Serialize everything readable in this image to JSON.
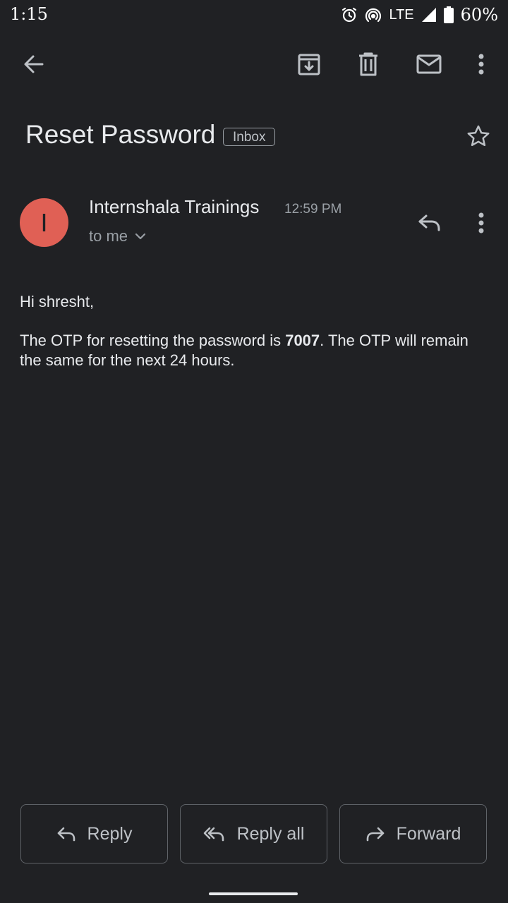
{
  "status_bar": {
    "time": "1:15",
    "network": "LTE",
    "battery_percent": "60%"
  },
  "toolbar": {
    "back_icon": "arrow-left-icon",
    "archive_icon": "archive-icon",
    "delete_icon": "trash-icon",
    "mark_unread_icon": "mail-icon",
    "more_icon": "more-vert-icon"
  },
  "email": {
    "subject": "Reset Password",
    "label": "Inbox",
    "starred": false,
    "sender": {
      "initial": "I",
      "name": "Internshala Trainings",
      "time": "12:59 PM",
      "recipients": "to me",
      "avatar_color": "#e06055"
    },
    "body": {
      "greeting": "Hi shresht,",
      "text_before": "The OTP for resetting the password is ",
      "otp": "7007",
      "text_after": ". The OTP will remain the same for the next 24 hours."
    }
  },
  "actions": {
    "reply": "Reply",
    "reply_all": "Reply all",
    "forward": "Forward"
  },
  "colors": {
    "background": "#202124",
    "text": "#e8eaed",
    "muted": "#9aa0a6"
  }
}
